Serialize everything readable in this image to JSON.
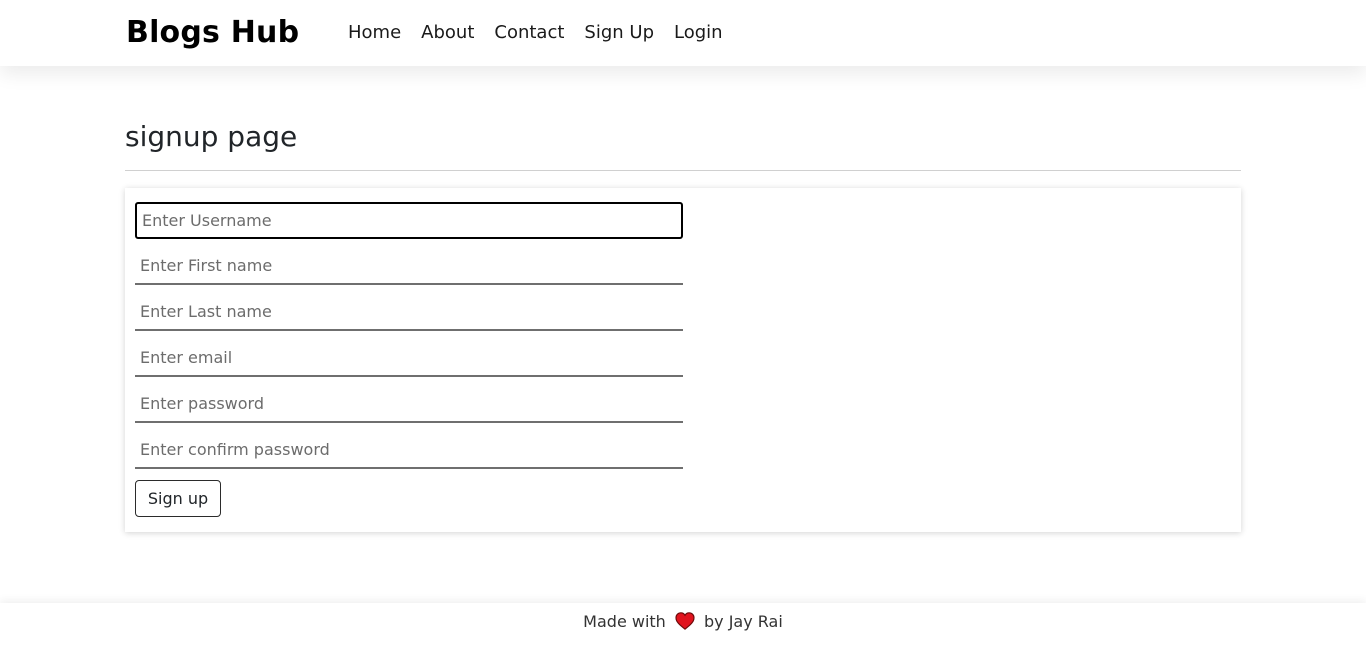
{
  "navbar": {
    "brand": "Blogs Hub",
    "links": [
      {
        "label": "Home"
      },
      {
        "label": "About"
      },
      {
        "label": "Contact"
      },
      {
        "label": "Sign Up"
      },
      {
        "label": "Login"
      }
    ]
  },
  "main": {
    "title": "signup page",
    "form": {
      "username_placeholder": "Enter Username",
      "first_name_placeholder": "Enter First name",
      "last_name_placeholder": "Enter Last name",
      "email_placeholder": "Enter email",
      "password_placeholder": "Enter password",
      "confirm_password_placeholder": "Enter confirm password",
      "submit_label": "Sign up"
    }
  },
  "footer": {
    "prefix": "Made with",
    "heart_icon": "heart-icon",
    "suffix": "by Jay Rai"
  },
  "colors": {
    "heart": "#e0141e"
  }
}
